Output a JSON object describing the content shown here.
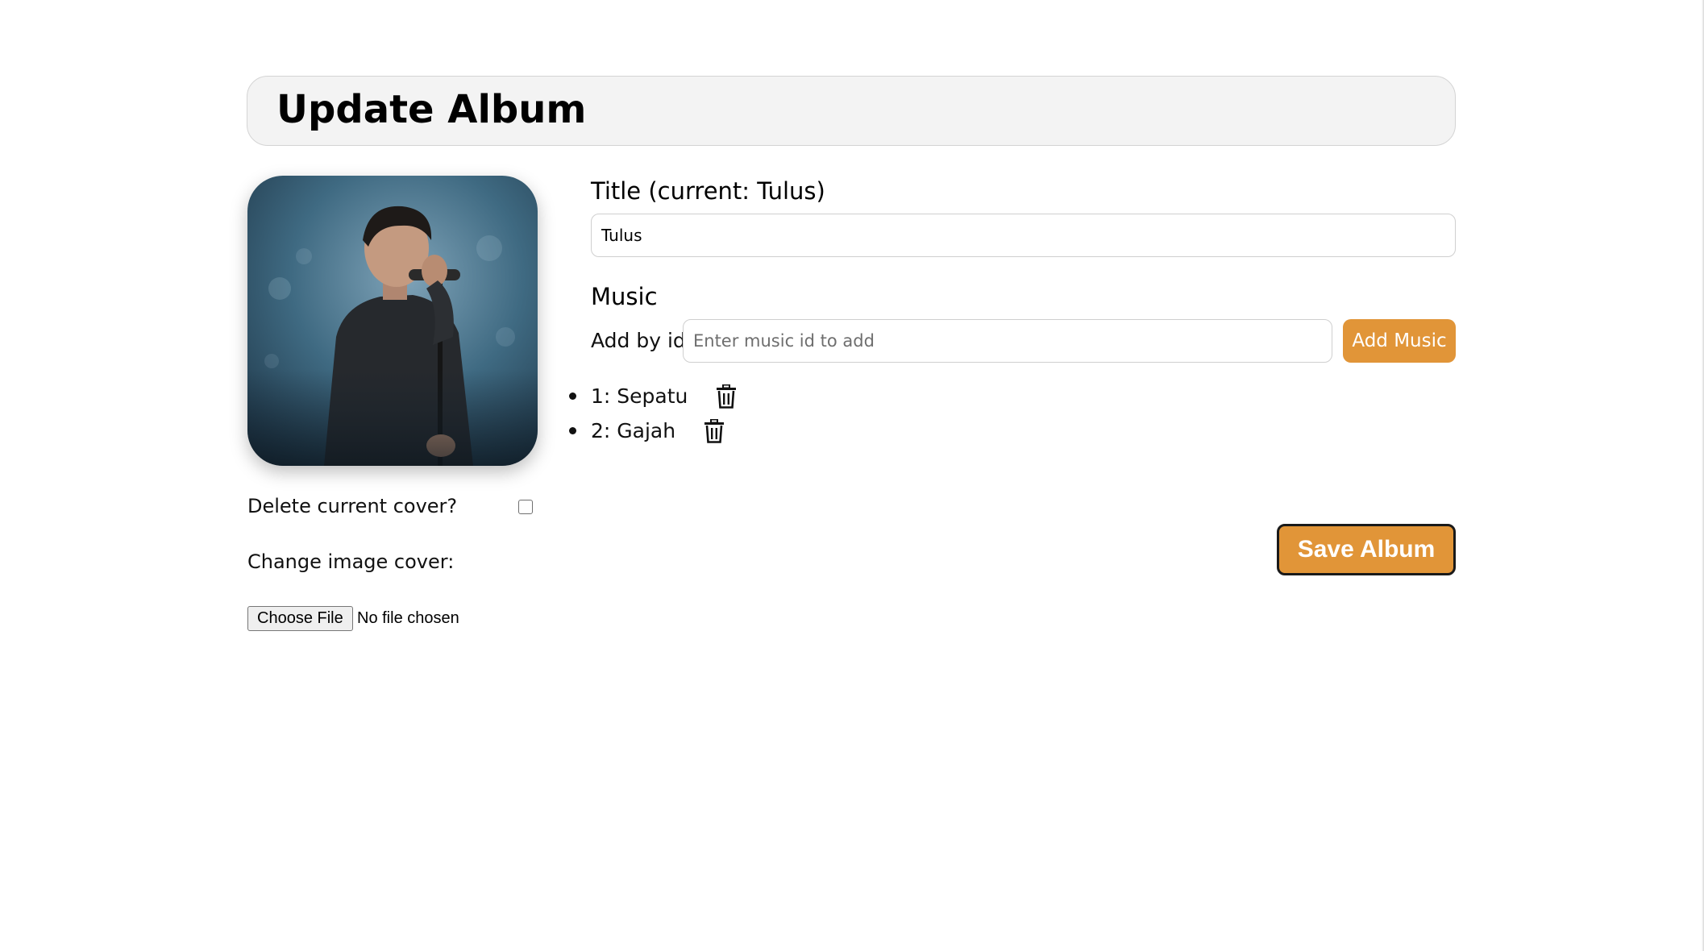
{
  "header": {
    "title": "Update Album"
  },
  "cover": {
    "icon": "album-cover-image"
  },
  "cover_options": {
    "delete_label": "Delete current cover?",
    "delete_checked": false,
    "change_label": "Change image cover:",
    "file_button_label": "Choose File",
    "file_status": "No file chosen"
  },
  "title_field": {
    "heading": "Title (current: Tulus)",
    "value": "Tulus"
  },
  "music": {
    "heading": "Music",
    "add_label": "Add by id:",
    "input_placeholder": "Enter music id to add",
    "add_button_label": "Add Music",
    "items": [
      {
        "label": "1: Sepatu",
        "icon": "trash-icon"
      },
      {
        "label": "2: Gajah",
        "icon": "trash-icon"
      }
    ]
  },
  "save_button_label": "Save Album",
  "colors": {
    "accent": "#e19538",
    "header_bg": "#f3f3f3"
  }
}
